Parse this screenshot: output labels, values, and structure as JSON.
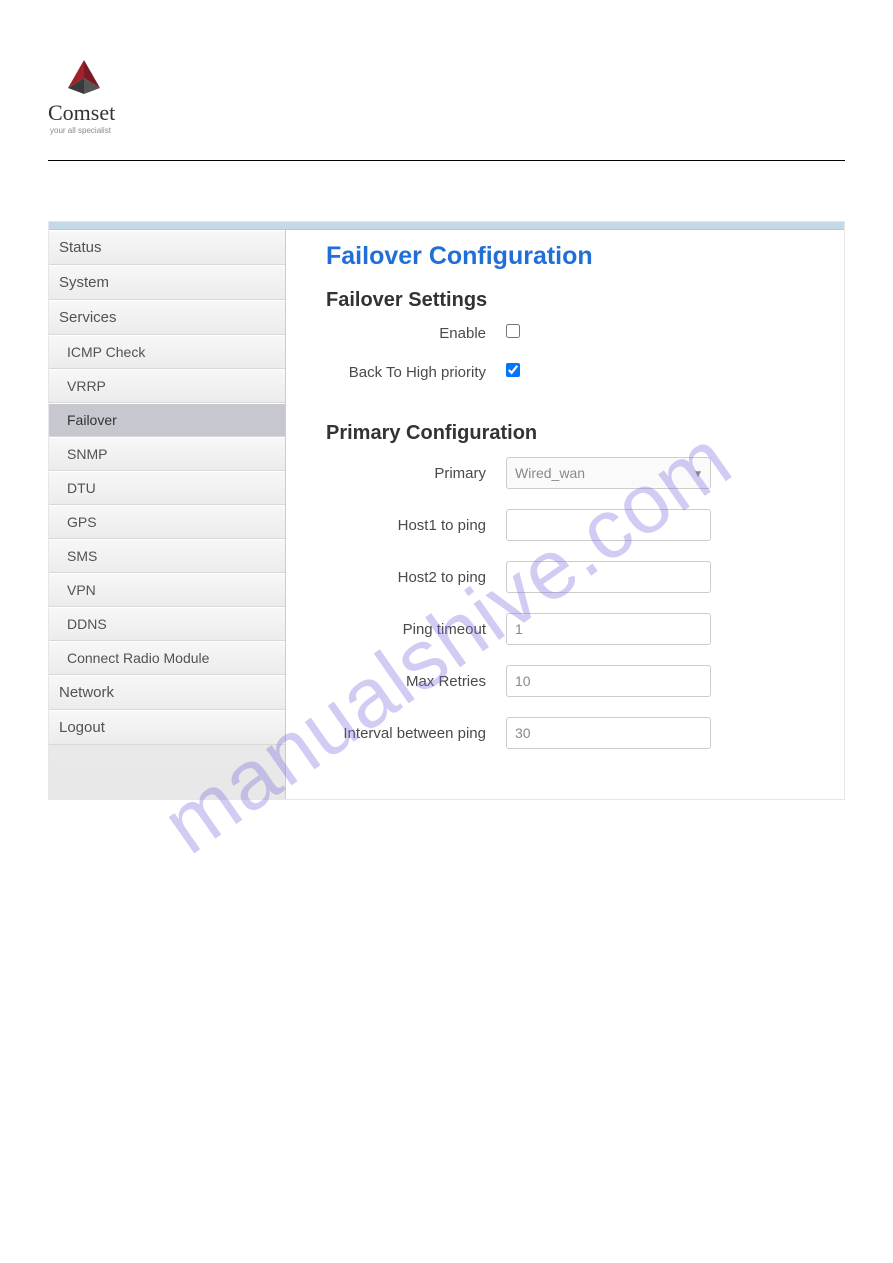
{
  "logo": {
    "brand": "Comset",
    "tagline": "your all specialist"
  },
  "sidebar": {
    "items": [
      {
        "label": "Status"
      },
      {
        "label": "System"
      },
      {
        "label": "Services"
      },
      {
        "label": "Network"
      },
      {
        "label": "Logout"
      }
    ],
    "services_submenu": [
      {
        "label": "ICMP Check"
      },
      {
        "label": "VRRP"
      },
      {
        "label": "Failover"
      },
      {
        "label": "SNMP"
      },
      {
        "label": "DTU"
      },
      {
        "label": "GPS"
      },
      {
        "label": "SMS"
      },
      {
        "label": "VPN"
      },
      {
        "label": "DDNS"
      },
      {
        "label": "Connect Radio Module"
      }
    ]
  },
  "main": {
    "title": "Failover Configuration",
    "section1": {
      "heading": "Failover Settings",
      "enable_label": "Enable",
      "back_label": "Back To High priority"
    },
    "section2": {
      "heading": "Primary Configuration",
      "primary_label": "Primary",
      "primary_value": "Wired_wan",
      "host1_label": "Host1 to ping",
      "host1_value": "",
      "host2_label": "Host2 to ping",
      "host2_value": "",
      "ping_timeout_label": "Ping timeout",
      "ping_timeout_value": "1",
      "max_retries_label": "Max Retries",
      "max_retries_value": "10",
      "interval_label": "Interval between ping",
      "interval_value": "30"
    }
  },
  "watermark": "manualshive.com"
}
